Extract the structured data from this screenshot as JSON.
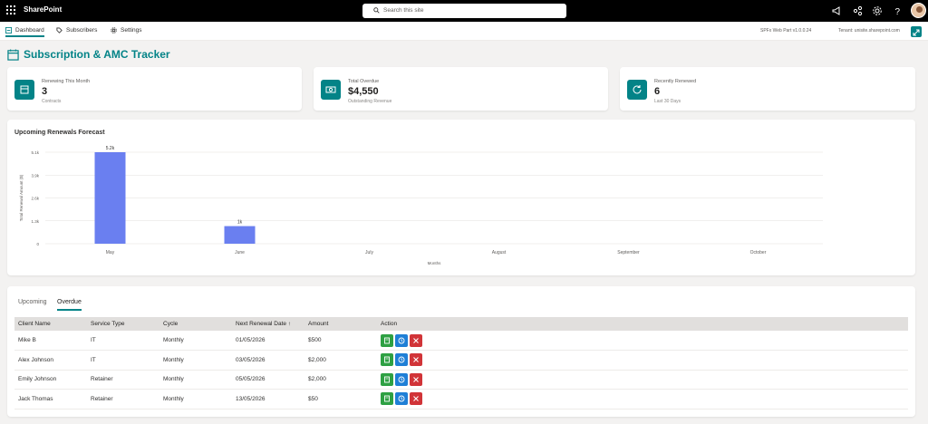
{
  "topbar": {
    "brand": "SharePoint",
    "search_placeholder": "Search this site"
  },
  "nav": {
    "tabs": [
      {
        "label": "Dashboard",
        "active": true
      },
      {
        "label": "Subscribers",
        "active": false
      },
      {
        "label": "Settings",
        "active": false
      }
    ],
    "version": "SPFx Web Part v1.0.0.24",
    "tenant": "Tenant: unisite.sharepoint.com"
  },
  "page": {
    "title": "Subscription & AMC Tracker"
  },
  "kpis": [
    {
      "label": "Renewing This Month",
      "value": "3",
      "sub": "Contracts",
      "icon": "calendar-icon"
    },
    {
      "label": "Total Overdue",
      "value": "$4,550",
      "sub": "Outstanding Revenue",
      "icon": "money-icon"
    },
    {
      "label": "Recently Renewed",
      "value": "6",
      "sub": "Last 30 Days",
      "icon": "refresh-icon"
    }
  ],
  "chart_data": {
    "type": "bar",
    "title": "Upcoming Renewals Forecast",
    "xlabel": "Months",
    "ylabel": "Total Renewal Amount ($)",
    "categories": [
      "May",
      "June",
      "July",
      "August",
      "September",
      "October"
    ],
    "values": [
      5200,
      1000,
      0,
      0,
      0,
      0
    ],
    "data_labels": [
      "5.2k",
      "1k",
      "",
      "",
      "",
      ""
    ],
    "yticks": [
      0,
      1300,
      2600,
      3900,
      5200
    ],
    "ytick_labels": [
      "0",
      "1.3k",
      "2.6k",
      "3.9k",
      "5.1k"
    ],
    "ylim": [
      0,
      5200
    ],
    "bar_color": "#6a7ff0",
    "grid": true
  },
  "renewals": {
    "tabs": [
      {
        "label": "Upcoming",
        "active": false
      },
      {
        "label": "Overdue",
        "active": true
      }
    ],
    "columns": [
      "Client Name",
      "Service Type",
      "Cycle",
      "Next Renewal Date ↑",
      "Amount",
      "Action"
    ],
    "rows": [
      {
        "client": "Mike B",
        "service": "IT",
        "cycle": "Monthly",
        "date": "01/05/2026",
        "amount": "$500"
      },
      {
        "client": "Alex Johnson",
        "service": "IT",
        "cycle": "Monthly",
        "date": "03/05/2026",
        "amount": "$2,000"
      },
      {
        "client": "Emily Johnson",
        "service": "Retainer",
        "cycle": "Monthly",
        "date": "05/05/2026",
        "amount": "$2,000"
      },
      {
        "client": "Jack Thomas",
        "service": "Retainer",
        "cycle": "Monthly",
        "date": "13/05/2026",
        "amount": "$50"
      }
    ],
    "action_colors": {
      "renew": "#2ea043",
      "history": "#1f7fd6",
      "delete": "#d13438"
    }
  },
  "colors": {
    "accent": "#038387",
    "bar": "#6a7ff0"
  }
}
